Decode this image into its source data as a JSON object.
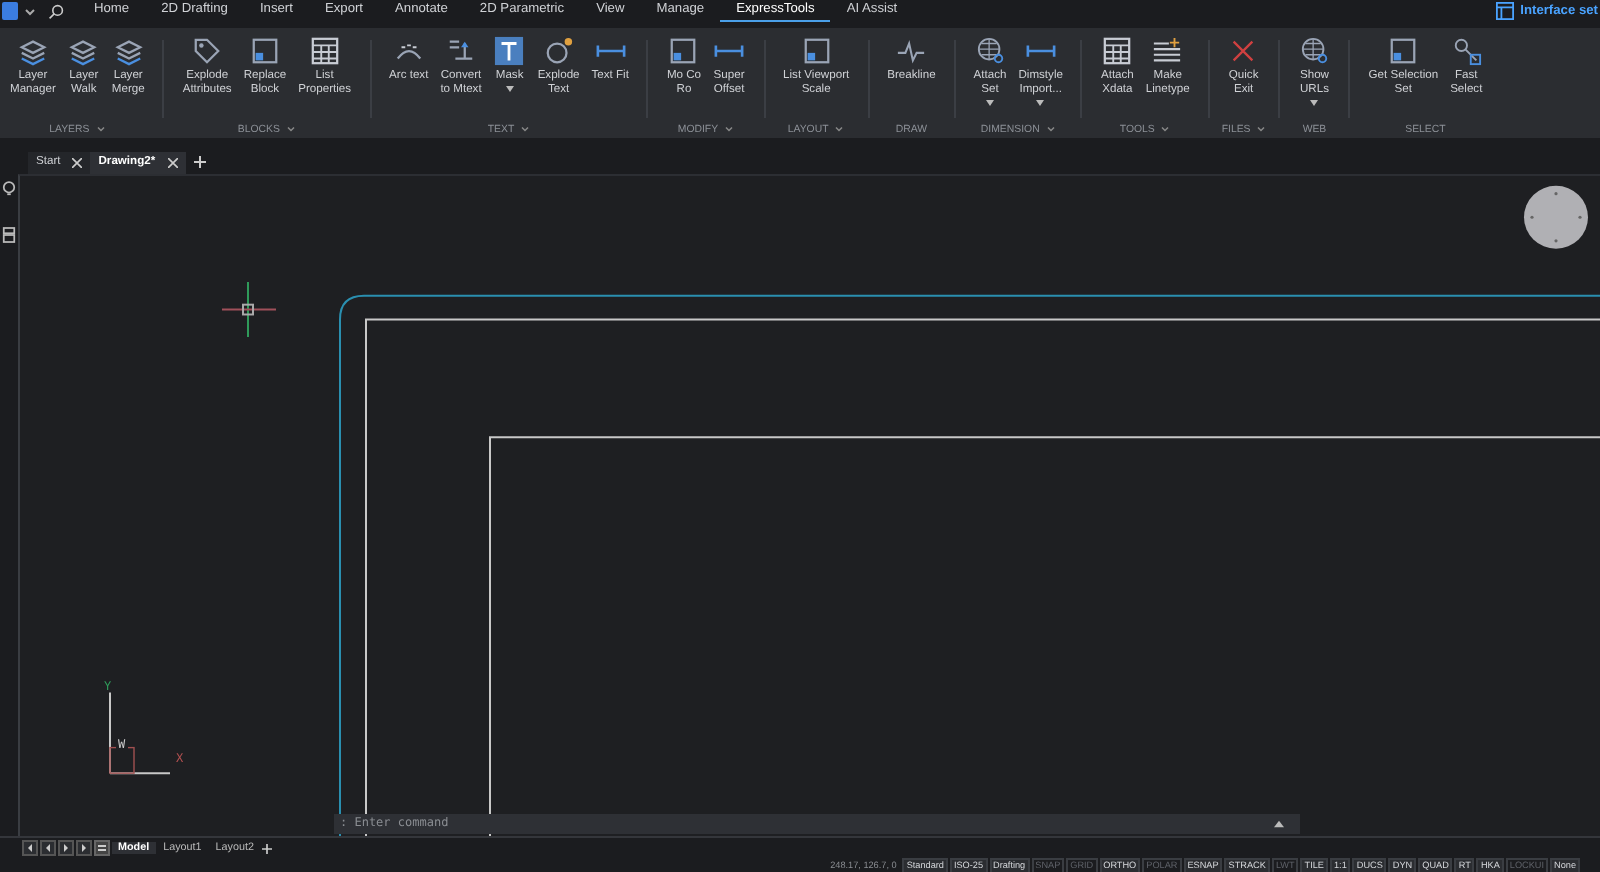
{
  "menu": [
    {
      "label": "Home",
      "selected": false
    },
    {
      "label": "2D Drafting",
      "selected": false
    },
    {
      "label": "Insert",
      "selected": false
    },
    {
      "label": "Export",
      "selected": false
    },
    {
      "label": "Annotate",
      "selected": false
    },
    {
      "label": "2D Parametric",
      "selected": false
    },
    {
      "label": "View",
      "selected": false
    },
    {
      "label": "Manage",
      "selected": false
    },
    {
      "label": "ExpressTools",
      "selected": true
    },
    {
      "label": "AI Assist",
      "selected": false
    }
  ],
  "workspace": {
    "label": "Interface set"
  },
  "panels": [
    {
      "title": "LAYERS",
      "dropdown": true,
      "buttons": [
        {
          "label": "Layer\nManager",
          "dropdown": false
        },
        {
          "label": "Layer\nWalk",
          "dropdown": false
        },
        {
          "label": "Layer\nMerge",
          "dropdown": false
        }
      ]
    },
    {
      "title": "BLOCKS",
      "dropdown": true,
      "buttons": [
        {
          "label": "Explode\nAttributes",
          "dropdown": false
        },
        {
          "label": "Replace\nBlock",
          "dropdown": false
        },
        {
          "label": "List\nProperties",
          "dropdown": false
        }
      ]
    },
    {
      "title": "TEXT",
      "dropdown": true,
      "buttons": [
        {
          "label": "Arc text",
          "dropdown": false
        },
        {
          "label": "Convert\nto Mtext",
          "dropdown": false
        },
        {
          "label": "Mask",
          "dropdown": true
        },
        {
          "label": "Explode\nText",
          "dropdown": false
        },
        {
          "label": "Text Fit",
          "dropdown": false
        }
      ]
    },
    {
      "title": "MODIFY",
      "dropdown": true,
      "buttons": [
        {
          "label": "Mo Co\nRo",
          "dropdown": false
        },
        {
          "label": "Super\nOffset",
          "dropdown": false
        }
      ]
    },
    {
      "title": "LAYOUT",
      "dropdown": true,
      "buttons": [
        {
          "label": "List Viewport\nScale",
          "dropdown": false
        }
      ]
    },
    {
      "title": "DRAW",
      "dropdown": false,
      "buttons": [
        {
          "label": "Breakline",
          "dropdown": false
        }
      ]
    },
    {
      "title": "DIMENSION",
      "dropdown": true,
      "buttons": [
        {
          "label": "Attach\nSet",
          "dropdown": true
        },
        {
          "label": "Dimstyle\nImport...",
          "dropdown": true
        }
      ]
    },
    {
      "title": "TOOLS",
      "dropdown": true,
      "buttons": [
        {
          "label": "Attach\nXdata",
          "dropdown": false
        },
        {
          "label": "Make\nLinetype",
          "dropdown": false
        }
      ]
    },
    {
      "title": "FILES",
      "dropdown": true,
      "buttons": [
        {
          "label": "Quick\nExit",
          "dropdown": false
        }
      ]
    },
    {
      "title": "WEB",
      "dropdown": false,
      "buttons": [
        {
          "label": "Show\nURLs",
          "dropdown": true
        }
      ]
    },
    {
      "title": "SELECT",
      "dropdown": false,
      "buttons": [
        {
          "label": "Get Selection\nSet",
          "dropdown": false
        },
        {
          "label": "Fast\nSelect",
          "dropdown": false
        }
      ]
    }
  ],
  "doc_tabs": [
    {
      "label": "Start",
      "selected": false
    },
    {
      "label": "Drawing2*",
      "selected": true
    }
  ],
  "ucs": {
    "y_label": "Y",
    "x_label": "X",
    "w_label": "W"
  },
  "command_line": {
    "placeholder": ": Enter command"
  },
  "layout_tabs": [
    {
      "label": "Model",
      "selected": true
    },
    {
      "label": "Layout1",
      "selected": false
    },
    {
      "label": "Layout2",
      "selected": false
    }
  ],
  "status_bar": {
    "coordinates": "248.17, 126.7, 0",
    "items": [
      {
        "label": "Standard",
        "on": true
      },
      {
        "label": "ISO-25",
        "on": true
      },
      {
        "label": "Drafting",
        "on": true
      },
      {
        "label": "SNAP",
        "on": false
      },
      {
        "label": "GRID",
        "on": false
      },
      {
        "label": "ORTHO",
        "on": true
      },
      {
        "label": "POLAR",
        "on": false
      },
      {
        "label": "ESNAP",
        "on": true
      },
      {
        "label": "STRACK",
        "on": true
      },
      {
        "label": "LWT",
        "on": false
      },
      {
        "label": "TILE",
        "on": true
      },
      {
        "label": "1:1",
        "on": true
      },
      {
        "label": "DUCS",
        "on": true
      },
      {
        "label": "DYN",
        "on": true
      },
      {
        "label": "QUAD",
        "on": true
      },
      {
        "label": "RT",
        "on": true
      },
      {
        "label": "HKA",
        "on": true
      },
      {
        "label": "LOCKUI",
        "on": false
      },
      {
        "label": "None",
        "on": true
      }
    ]
  }
}
